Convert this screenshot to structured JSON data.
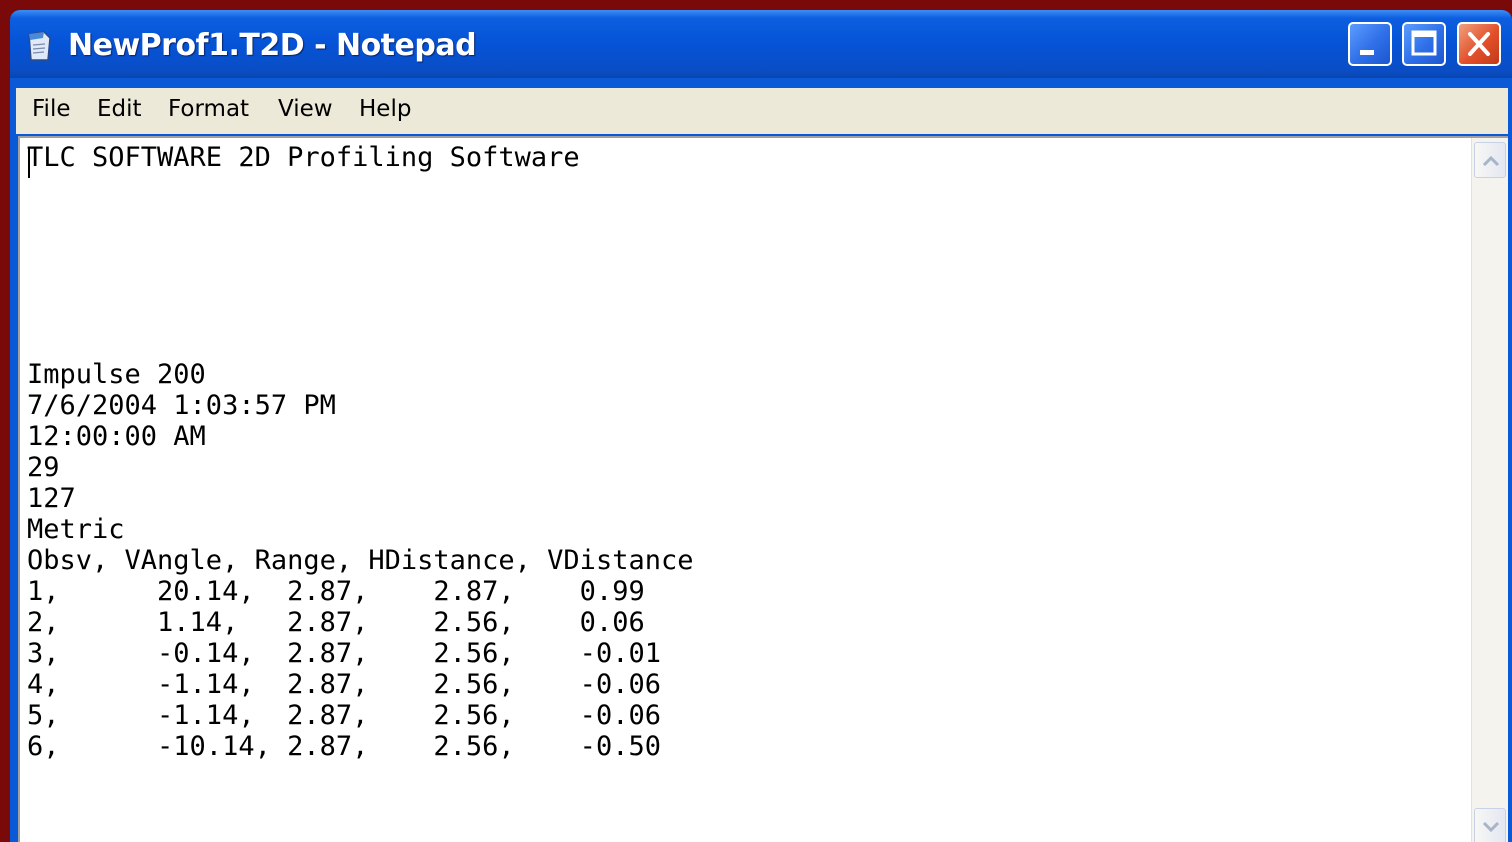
{
  "window": {
    "title": "NewProf1.T2D - Notepad",
    "icons": {
      "app": "notepad-icon",
      "minimize": "minimize-icon",
      "maximize": "maximize-icon",
      "close": "close-icon"
    }
  },
  "menu": {
    "file": "File",
    "edit": "Edit",
    "format": "Format",
    "view": "View",
    "help": "Help"
  },
  "document": {
    "text": "TLC SOFTWARE 2D Profiling Software\n\n\n\n\n\n\nImpulse 200\n7/6/2004 1:03:57 PM\n12:00:00 AM\n29\n127\nMetric\nObsv, VAngle, Range, HDistance, VDistance\n1,      20.14,  2.87,    2.87,    0.99\n2,      1.14,   2.87,    2.56,    0.06\n3,      -0.14,  2.87,    2.56,    -0.01\n4,      -1.14,  2.87,    2.56,    -0.06\n5,      -1.14,  2.87,    2.56,    -0.06\n6,      -10.14, 2.87,    2.56,    -0.50"
  },
  "scrollbar": {
    "up_icon": "scroll-up-arrow-icon",
    "down_icon": "scroll-down-arrow-icon"
  },
  "colors": {
    "titlebar": "#0553d6",
    "menubar": "#ece9d8",
    "close_button": "#e2502a",
    "desktop": "#7a0a0a"
  }
}
